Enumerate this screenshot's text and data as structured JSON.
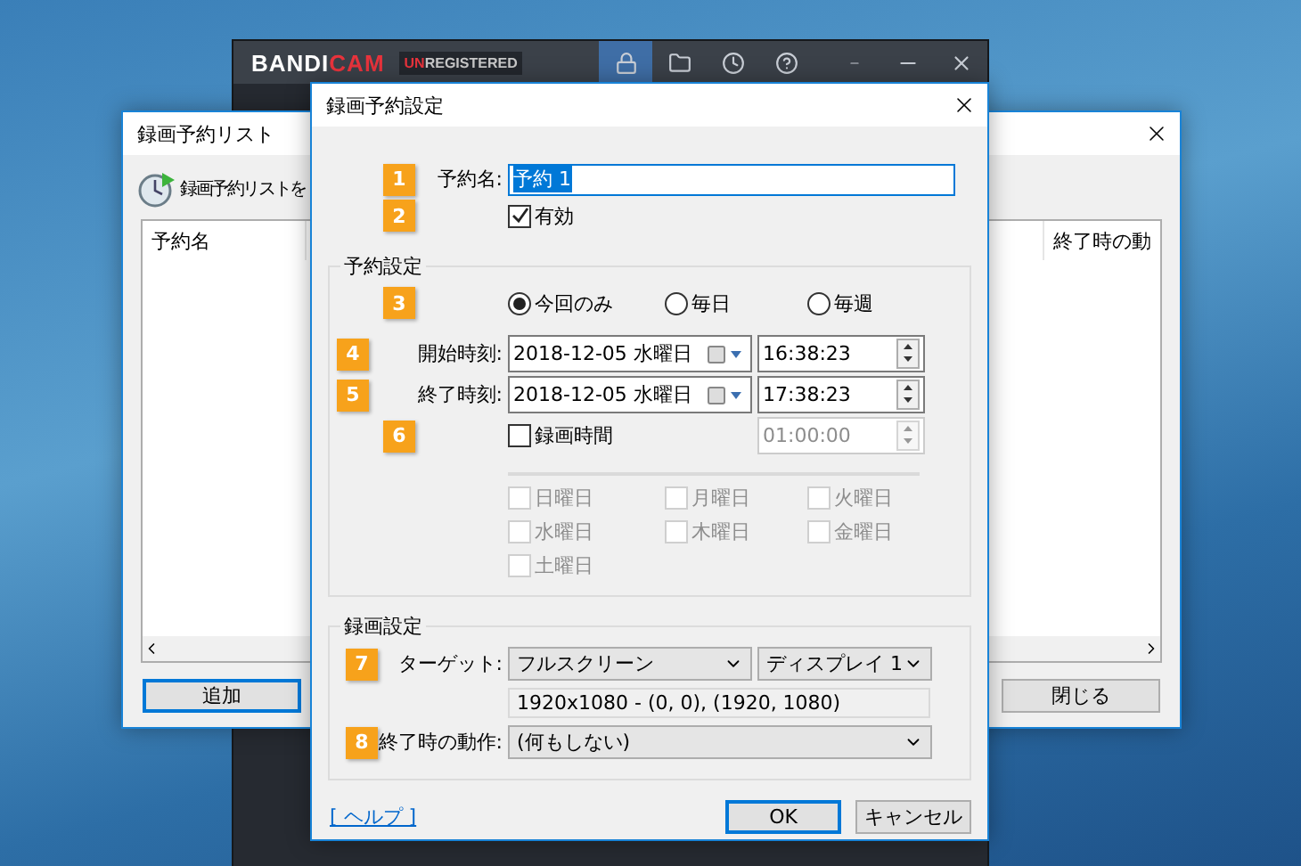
{
  "main_window": {
    "logo": [
      {
        "text": "BANDI",
        "color": "#ffffff"
      },
      {
        "text": "CAM",
        "color": "#e8333c"
      }
    ],
    "license_badge": [
      {
        "text": "UN",
        "color": "#e8333c"
      },
      {
        "text": "REGISTERED",
        "color": "#c9c9c9"
      }
    ],
    "toolbar": [
      {
        "kind": "lock",
        "selected": true
      },
      {
        "kind": "folder",
        "selected": false
      },
      {
        "kind": "clock",
        "selected": false
      },
      {
        "kind": "help",
        "selected": false
      }
    ],
    "window_controls": [
      {
        "kind": "mini"
      },
      {
        "kind": "minimize"
      },
      {
        "kind": "close"
      }
    ]
  },
  "list_window": {
    "title": "録画予約リスト",
    "heading": "録画予約リストを",
    "columns": [
      "予約名",
      "終了時の動"
    ],
    "buttons": [
      {
        "label": "追加",
        "focused": true
      },
      {
        "label": "閉じる",
        "focused": false
      }
    ]
  },
  "dialog": {
    "title": "録画予約設定",
    "name": {
      "marker": "1",
      "label": "予約名:",
      "value": "予約 1",
      "text_selected": true
    },
    "enabled": {
      "marker": "2",
      "label": "有効",
      "checked": true
    },
    "schedule": {
      "legend": "予約設定",
      "marker": "3",
      "repeat_options": [
        {
          "label": "今回のみ",
          "selected": true
        },
        {
          "label": "毎日",
          "selected": false
        },
        {
          "label": "毎週",
          "selected": false
        }
      ],
      "start": {
        "marker": "4",
        "label": "開始時刻:",
        "date": "2018-12-05 水曜日",
        "time": "16:38:23"
      },
      "end": {
        "marker": "5",
        "label": "終了時刻:",
        "date": "2018-12-05 水曜日",
        "time": "17:38:23"
      },
      "duration": {
        "marker": "6",
        "label": "録画時間",
        "checked": false,
        "time": "01:00:00",
        "disabled": true
      },
      "weekdays_disabled": true,
      "weekdays": [
        {
          "label": "日曜日",
          "checked": false
        },
        {
          "label": "月曜日",
          "checked": false
        },
        {
          "label": "火曜日",
          "checked": false
        },
        {
          "label": "水曜日",
          "checked": false
        },
        {
          "label": "木曜日",
          "checked": false
        },
        {
          "label": "金曜日",
          "checked": false
        },
        {
          "label": "土曜日",
          "checked": false
        }
      ]
    },
    "recording": {
      "legend": "録画設定",
      "target": {
        "marker": "7",
        "label": "ターゲット:",
        "mode": "フルスクリーン",
        "display": "ディスプレイ 1",
        "area": "1920x1080 - (0, 0), (1920, 1080)"
      },
      "on_end": {
        "marker": "8",
        "label": "終了時の動作:",
        "value": "(何もしない)"
      }
    },
    "help_link": "[ ヘルプ ]",
    "buttons": [
      {
        "label": "OK",
        "focused": true
      },
      {
        "label": "キャンセル",
        "focused": false
      }
    ]
  }
}
